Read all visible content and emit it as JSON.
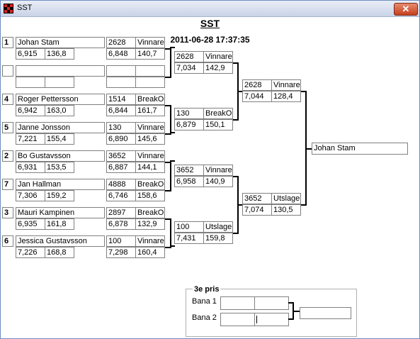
{
  "window": {
    "title": "SST"
  },
  "header": {
    "title": "SST",
    "timestamp": "2011-06-28 17:37:35"
  },
  "round1": [
    {
      "seed": "1",
      "name": "Johan Stam",
      "rt": "6,915",
      "speed": "136,8",
      "id": "2628",
      "status": "Vinnare",
      "et": "6,848",
      "mph": "140,7"
    },
    {
      "seed": "",
      "name": "",
      "rt": "",
      "speed": "",
      "id": "",
      "status": "",
      "et": "",
      "mph": ""
    },
    {
      "seed": "4",
      "name": "Roger Pettersson",
      "rt": "6,942",
      "speed": "163,0",
      "id": "1514",
      "status": "BreakOut",
      "et": "6,844",
      "mph": "161,7"
    },
    {
      "seed": "5",
      "name": "Janne Jonsson",
      "rt": "7,221",
      "speed": "155,4",
      "id": "130",
      "status": "Vinnare",
      "et": "6,890",
      "mph": "145,6"
    },
    {
      "seed": "2",
      "name": "Bo Gustavsson",
      "rt": "6,931",
      "speed": "153,5",
      "id": "3652",
      "status": "Vinnare",
      "et": "6,887",
      "mph": "144,1"
    },
    {
      "seed": "7",
      "name": "Jan Hallman",
      "rt": "7,306",
      "speed": "159,2",
      "id": "4888",
      "status": "BreakOut",
      "et": "6,746",
      "mph": "158,6"
    },
    {
      "seed": "3",
      "name": "Mauri Kampinen",
      "rt": "6,935",
      "speed": "161,8",
      "id": "2897",
      "status": "BreakOut",
      "et": "6,878",
      "mph": "132,9"
    },
    {
      "seed": "6",
      "name": "Jessica Gustavsson",
      "rt": "7,226",
      "speed": "168,8",
      "id": "100",
      "status": "Vinnare",
      "et": "7,298",
      "mph": "160,4"
    }
  ],
  "round2": [
    {
      "id": "2628",
      "status": "Vinnare",
      "et": "7,034",
      "mph": "142,9"
    },
    {
      "id": "130",
      "status": "BreakOut",
      "et": "6,879",
      "mph": "150,1"
    },
    {
      "id": "3652",
      "status": "Vinnare",
      "et": "6,958",
      "mph": "140,9"
    },
    {
      "id": "100",
      "status": "Utslagen",
      "et": "7,431",
      "mph": "159,8"
    }
  ],
  "round3": [
    {
      "id": "2628",
      "status": "Vinnare",
      "et": "7,044",
      "mph": "128,4"
    },
    {
      "id": "3652",
      "status": "Utslagen",
      "et": "7,074",
      "mph": "130,5"
    }
  ],
  "winner": {
    "name": "Johan Stam"
  },
  "third_place": {
    "title": "3e pris",
    "lane1": "Bana 1",
    "lane2": "Bana 2"
  }
}
